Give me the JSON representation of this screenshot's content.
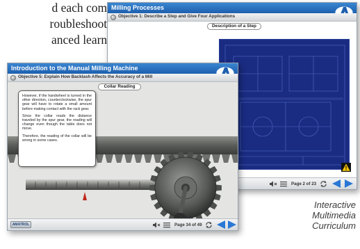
{
  "page_text": {
    "lines": [
      "d each com-",
      "roubleshoot-",
      "anced learn-"
    ]
  },
  "caption": [
    "Interactive",
    "Multimedia",
    "Curriculum"
  ],
  "back_window": {
    "title": "Milling Processes",
    "objective": "Objective 1: Describe a Step and Give Four Applications",
    "button_label": "Description of a Step",
    "page_indicator": "Page 2 of 23",
    "colors": {
      "titlebar": "#2a74c4",
      "blueprint": "#1a2c82",
      "nav_arrow": "#2a78d4"
    }
  },
  "front_window": {
    "title": "Introduction to the Manual Milling Machine",
    "objective": "Objective 5: Explain How Backlash Affects the Accuracy of a Mill",
    "button_label": "Collar Reading",
    "paragraphs": [
      "However, if the handwheel is turned in the other direction, counterclockwise, the spur gear will have to rotate a small amount before making contact with the rack gear.",
      "Since the collar reads the distance traveled by the spur gear, the reading will change even though the table does not move.",
      "Therefore, the reading of the collar will be wrong in some cases."
    ],
    "page_indicator": "Page 34 of 49",
    "footer_logo": "AMATROL"
  },
  "icons": [
    "logo-icon",
    "mute-icon",
    "menu-icon",
    "reload-icon",
    "prev-arrow-icon",
    "next-arrow-icon",
    "warning-icon",
    "objective-dot-icon"
  ]
}
